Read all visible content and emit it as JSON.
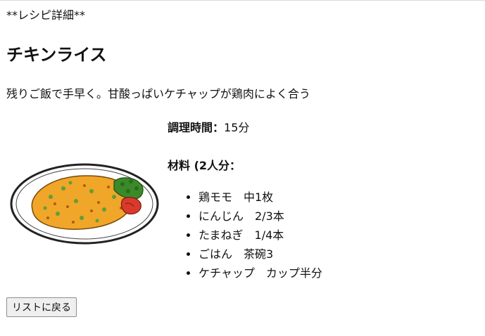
{
  "page": {
    "heading_marker": "**レシピ詳細**",
    "title": "チキンライス",
    "description": "残りご飯で手早く。甘酸っぱいケチャップが鶏肉によく合う"
  },
  "recipe": {
    "time_label": "調理時間：",
    "time_value": "15分",
    "ingredients_label": "材料 (2人分：",
    "ingredients": [
      "鶏モモ　中1枚",
      "にんじん　2/3本",
      "たまねぎ　1/4本",
      "ごはん　茶碗3",
      "ケチャップ　カップ半分"
    ]
  },
  "image": {
    "icon": "chicken-rice-plate-illustration"
  },
  "actions": {
    "back_label": "リストに戻る"
  }
}
